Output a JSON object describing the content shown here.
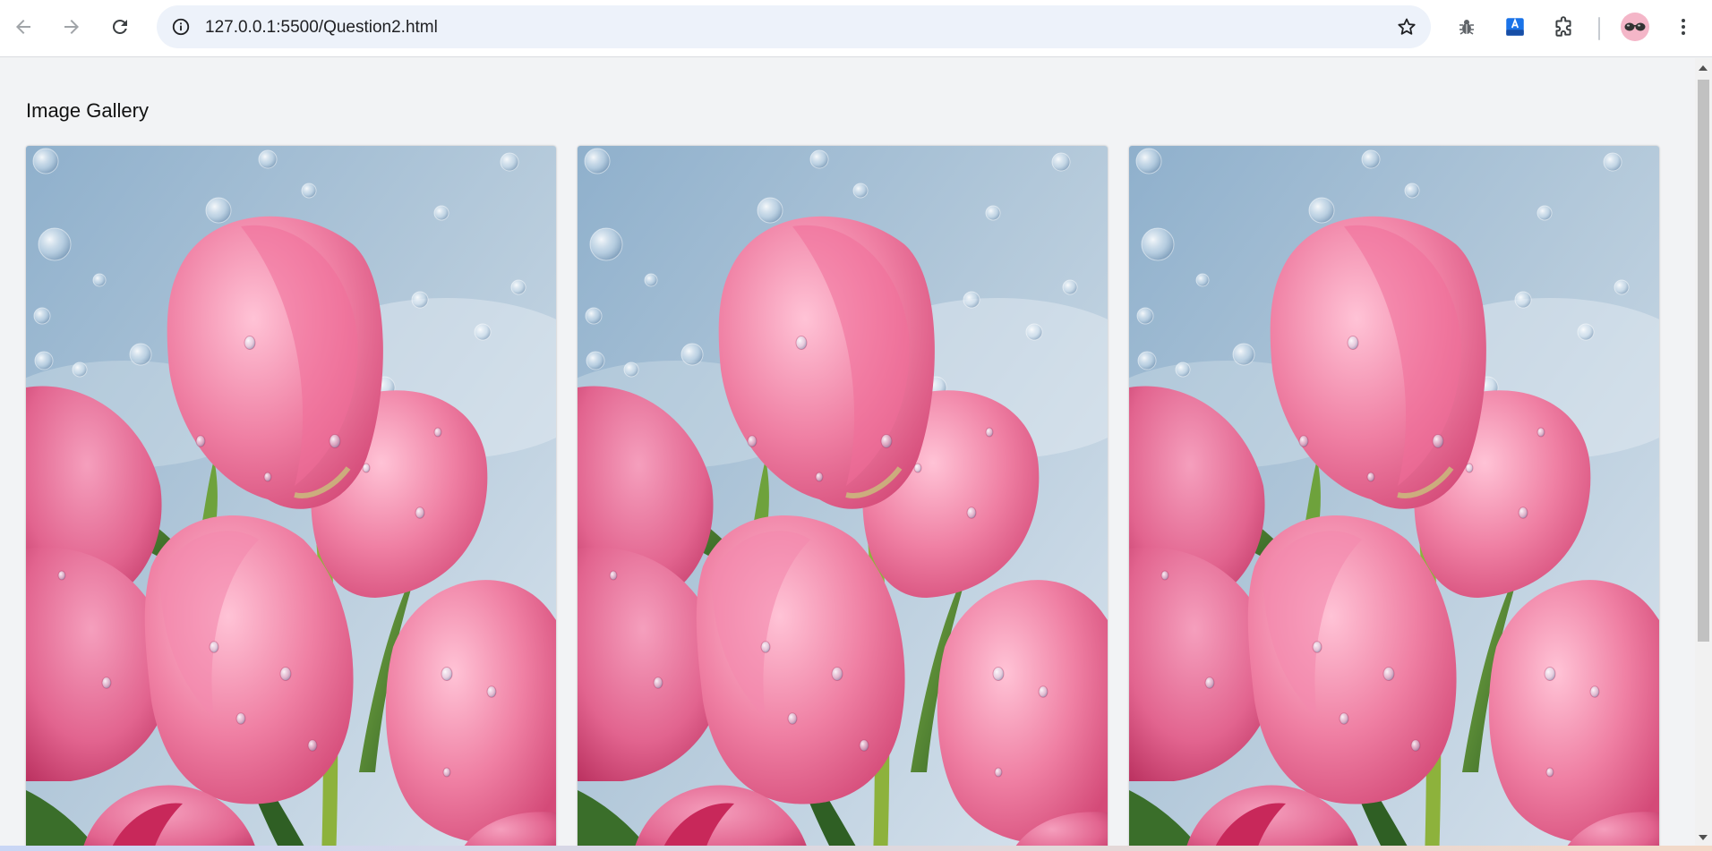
{
  "browser": {
    "url": "127.0.0.1:5500/Question2.html",
    "icons": {
      "back": "arrow-left-icon",
      "forward": "arrow-right-icon",
      "reload": "reload-icon",
      "site_info": "info-icon",
      "bookmark": "star-icon",
      "extension_bug": "bug-icon",
      "extension_translate": "translate-icon",
      "extensions": "puzzle-icon",
      "menu": "kebab-menu-icon"
    }
  },
  "page": {
    "title": "Image Gallery",
    "gallery": [
      {
        "image": "pink tulips with water droplets"
      },
      {
        "image": "pink tulips with water droplets"
      },
      {
        "image": "pink tulips with water droplets"
      }
    ]
  },
  "colors": {
    "tulip_pink": "#ef7fa3",
    "sky": "#b5cadb",
    "stem_green": "#4f8a2e",
    "omnibox": "#edf2fa"
  }
}
